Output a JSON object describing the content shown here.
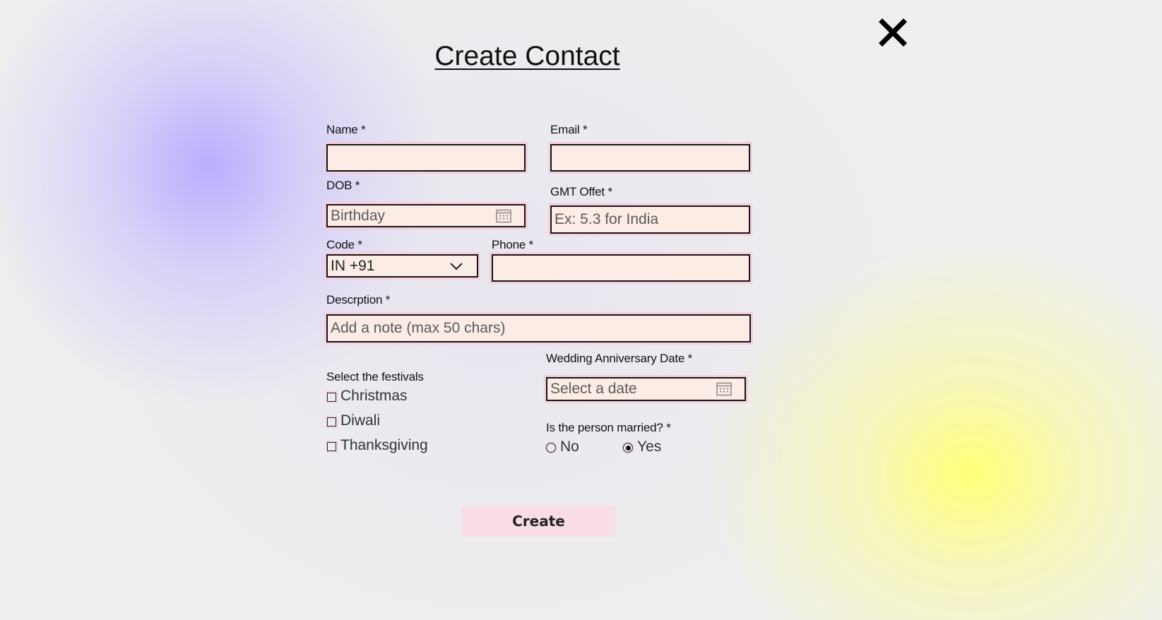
{
  "header": {
    "title": "Create Contact",
    "close_icon": "close-icon"
  },
  "form": {
    "name": {
      "label": "Name *",
      "value": ""
    },
    "email": {
      "label": "Email *",
      "value": ""
    },
    "dob": {
      "label": "DOB *",
      "placeholder": "Birthday",
      "icon": "calendar-icon"
    },
    "gmt_offset": {
      "label": "GMT Offet *",
      "placeholder": "Ex: 5.3 for India"
    },
    "code": {
      "label": "Code *",
      "selected": "IN +91",
      "icon": "chevron-down-icon"
    },
    "phone": {
      "label": "Phone *",
      "value": ""
    },
    "description": {
      "label": "Descrption *",
      "placeholder": "Add a note (max 50 chars)"
    },
    "festivals": {
      "label": "Select the festivals",
      "options": [
        {
          "label": "Christmas",
          "checked": false
        },
        {
          "label": "Diwali",
          "checked": false
        },
        {
          "label": "Thanksgiving",
          "checked": false
        }
      ]
    },
    "anniversary": {
      "label": "Wedding Anniversary Date *",
      "placeholder": "Select a date",
      "icon": "calendar-icon"
    },
    "married": {
      "label": "Is the person married? *",
      "options": [
        {
          "label": "No",
          "selected": false
        },
        {
          "label": "Yes",
          "selected": true
        }
      ]
    },
    "submit_label": "Create"
  },
  "colors": {
    "field_background": "#fcece6",
    "field_border": "#141414",
    "button_background": "#f8dde5",
    "glow_purple": "#b9aaff",
    "glow_yellow": "#ffff78"
  }
}
